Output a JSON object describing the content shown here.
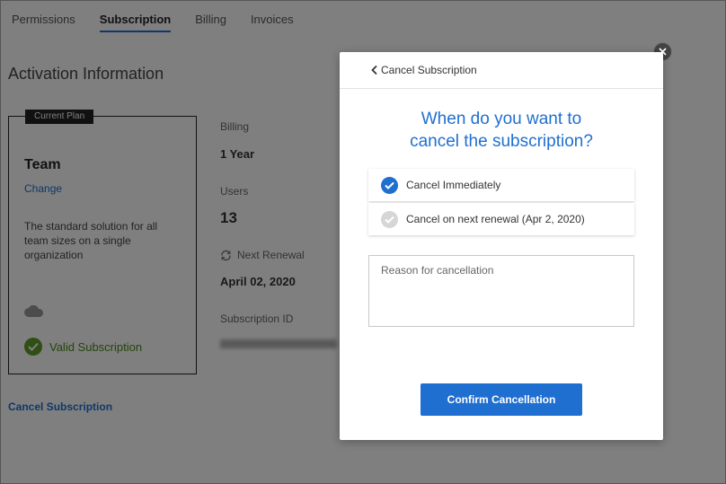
{
  "tabs": [
    {
      "label": "Permissions",
      "active": false
    },
    {
      "label": "Subscription",
      "active": true
    },
    {
      "label": "Billing",
      "active": false
    },
    {
      "label": "Invoices",
      "active": false
    }
  ],
  "page": {
    "title": "Activation Information",
    "cancel_link": "Cancel Subscription"
  },
  "plan": {
    "badge": "Current Plan",
    "name": "Team",
    "change_label": "Change",
    "description": "The standard solution for all team sizes on a single organization",
    "status": "Valid Subscription",
    "status_color": "#5e9e2a"
  },
  "info": {
    "billing_label": "Billing",
    "billing_value": "1 Year",
    "users_label": "Users",
    "users_value": "13",
    "renewal_label": "Next Renewal",
    "renewal_value": "April 02, 2020",
    "subscription_id_label": "Subscription ID"
  },
  "modal": {
    "back_label": "Cancel Subscription",
    "question_line1": "When do you want to",
    "question_line2": "cancel the subscription?",
    "options": [
      {
        "label": "Cancel Immediately",
        "selected": true
      },
      {
        "label": "Cancel on next renewal (Apr 2, 2020)",
        "selected": false
      }
    ],
    "reason_placeholder": "Reason for cancellation",
    "confirm_label": "Confirm Cancellation",
    "accent_color": "#1f6fd1"
  }
}
